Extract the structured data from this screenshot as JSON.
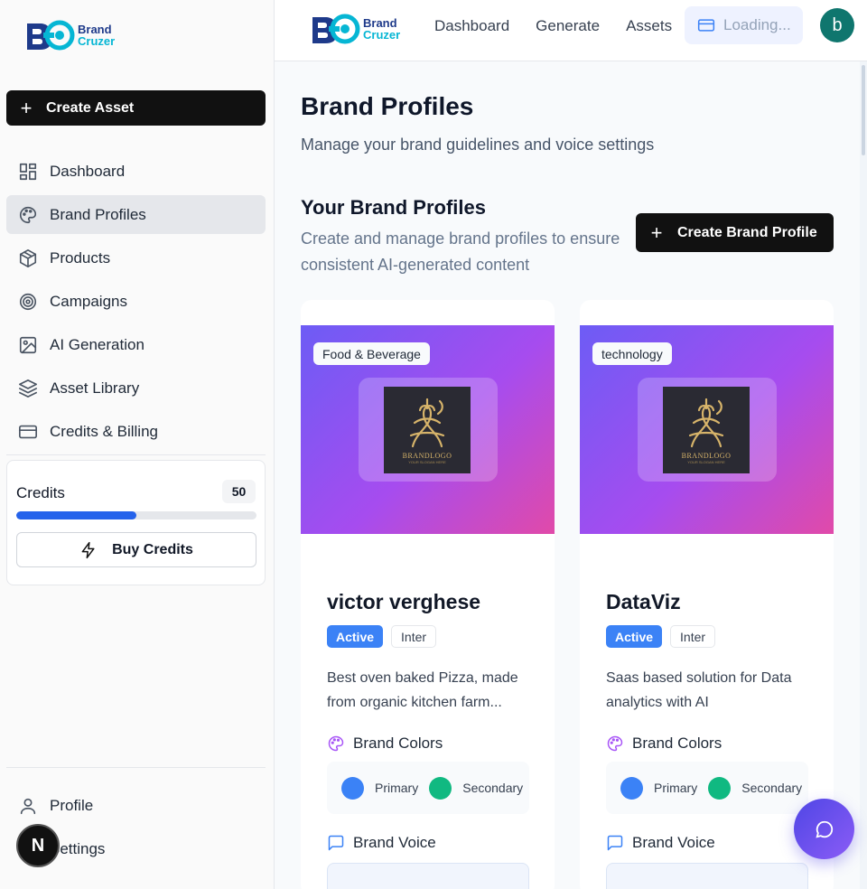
{
  "brand": {
    "line1": "Brand",
    "line2": "Cruzer"
  },
  "sidebar": {
    "create_label": "Create Asset",
    "items": [
      {
        "label": "Dashboard",
        "icon": "dashboard-grid-icon"
      },
      {
        "label": "Brand Profiles",
        "icon": "palette-icon",
        "active": true
      },
      {
        "label": "Products",
        "icon": "box-icon"
      },
      {
        "label": "Campaigns",
        "icon": "target-icon"
      },
      {
        "label": "AI Generation",
        "icon": "image-icon"
      },
      {
        "label": "Asset Library",
        "icon": "layers-icon"
      },
      {
        "label": "Credits & Billing",
        "icon": "credit-card-icon"
      }
    ],
    "credits": {
      "label": "Credits",
      "count": "50",
      "progress": 0.5,
      "buy_label": "Buy Credits"
    },
    "bottom": [
      {
        "label": "Profile",
        "icon": "user-icon"
      },
      {
        "label": "Settings",
        "icon": "settings-icon"
      }
    ],
    "dev_badge": "N"
  },
  "topbar": {
    "nav": [
      "Dashboard",
      "Generate",
      "Assets"
    ],
    "loading_label": "Loading...",
    "avatar_letter": "b"
  },
  "main": {
    "title": "Brand Profiles",
    "subtitle": "Manage your brand guidelines and voice settings",
    "section_title": "Your Brand Profiles",
    "section_desc": "Create and manage brand profiles to ensure consistent AI-generated content",
    "create_profile_label": "Create Brand Profile"
  },
  "cards": [
    {
      "industry": "Food & Beverage",
      "logo_text": "BRANDLOGO",
      "logo_small": "YOUR SLOGAN HERE",
      "name": "victor verghese",
      "status": "Active",
      "font": "Inter",
      "description": "Best oven baked Pizza, made from organic kitchen farm...",
      "colors_heading": "Brand Colors",
      "primary_label": "Primary",
      "secondary_label": "Secondary",
      "primary_color": "#3b82f6",
      "secondary_color": "#10b981",
      "voice_heading": "Brand Voice"
    },
    {
      "industry": "technology",
      "logo_text": "BRANDLOGO",
      "logo_small": "YOUR SLOGAN HERE",
      "name": "DataViz",
      "status": "Active",
      "font": "Inter",
      "description": "Saas based solution for Data analytics with AI",
      "colors_heading": "Brand Colors",
      "primary_label": "Primary",
      "secondary_label": "Secondary",
      "primary_color": "#3b82f6",
      "secondary_color": "#10b981",
      "voice_heading": "Brand Voice"
    }
  ]
}
